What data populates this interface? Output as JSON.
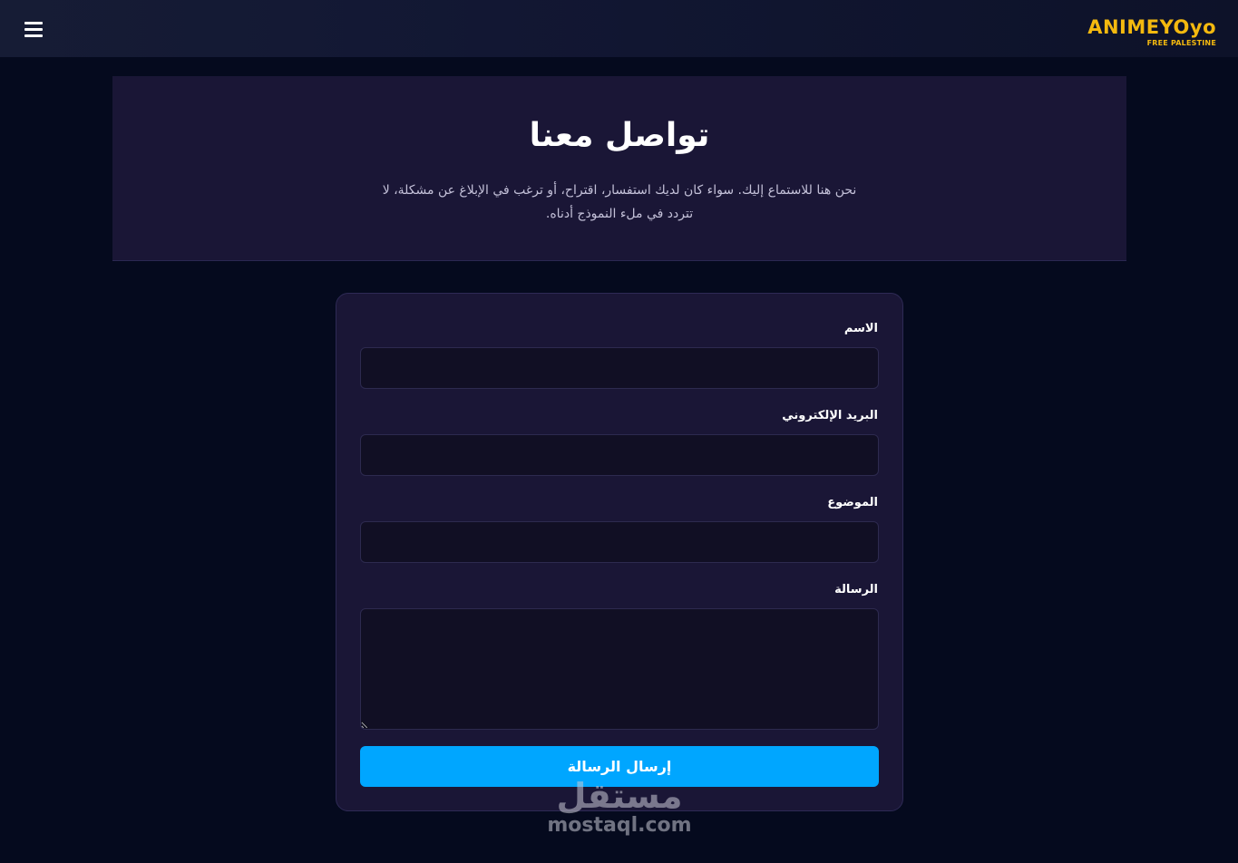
{
  "navbar": {
    "menu_icon": "hamburger-menu-icon",
    "logo_main": "ANIMEYOyo",
    "logo_sub": "FREE PALESTINE",
    "brand_color": "#f4b90f"
  },
  "hero": {
    "title": "تواصل معنا",
    "description": "نحن هنا للاستماع إليك. سواء كان لديك استفسار، اقتراح، أو ترغب في الإبلاغ عن مشكلة، لا تتردد في ملء النموذج أدناه."
  },
  "form": {
    "name_label": "الاسم",
    "name_value": "",
    "email_label": "البريد الإلكتروني",
    "email_value": "",
    "subject_label": "الموضوع",
    "subject_value": "",
    "message_label": "الرسالة",
    "message_value": "",
    "submit_label": "إرسال الرسالة",
    "accent_color": "#00a6ff"
  },
  "watermark": {
    "arabic": "مستقل",
    "latin": "mostaql.com"
  }
}
